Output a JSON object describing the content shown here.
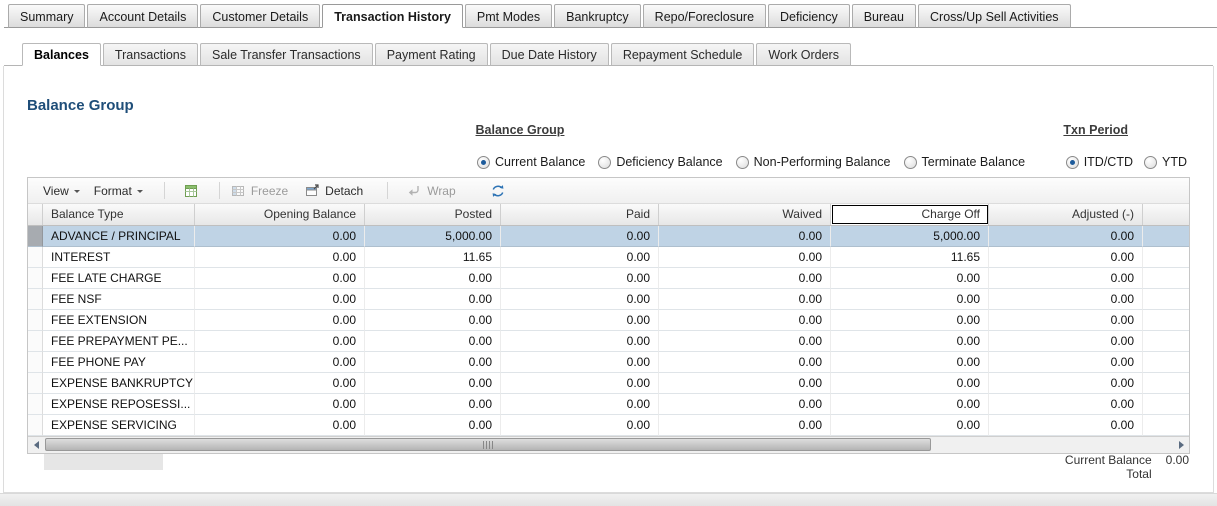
{
  "colors": {
    "heading": "#1f4e79",
    "selected_row": "#bfd3e5",
    "accent_blue": "#1d5b9b"
  },
  "tabs": {
    "top": [
      {
        "label": "Summary",
        "active": false
      },
      {
        "label": "Account Details",
        "active": false
      },
      {
        "label": "Customer Details",
        "active": false
      },
      {
        "label": "Transaction History",
        "active": true
      },
      {
        "label": "Pmt Modes",
        "active": false
      },
      {
        "label": "Bankruptcy",
        "active": false
      },
      {
        "label": "Repo/Foreclosure",
        "active": false
      },
      {
        "label": "Deficiency",
        "active": false
      },
      {
        "label": "Bureau",
        "active": false
      },
      {
        "label": "Cross/Up Sell Activities",
        "active": false
      }
    ],
    "sub": [
      {
        "label": "Balances",
        "active": true
      },
      {
        "label": "Transactions",
        "active": false
      },
      {
        "label": "Sale Transfer Transactions",
        "active": false
      },
      {
        "label": "Payment Rating",
        "active": false
      },
      {
        "label": "Due Date History",
        "active": false
      },
      {
        "label": "Repayment Schedule",
        "active": false
      },
      {
        "label": "Work Orders",
        "active": false
      }
    ]
  },
  "section_title": "Balance Group",
  "filters": {
    "balance_group_label": "Balance Group",
    "txn_period_label": "Txn Period",
    "balance_group_options": [
      {
        "label": "Current Balance",
        "selected": true
      },
      {
        "label": "Deficiency Balance",
        "selected": false
      },
      {
        "label": "Non-Performing Balance",
        "selected": false
      },
      {
        "label": "Terminate Balance",
        "selected": false
      }
    ],
    "txn_period_options": [
      {
        "label": "ITD/CTD",
        "selected": true
      },
      {
        "label": "YTD",
        "selected": false
      }
    ]
  },
  "toolbar": {
    "view": "View",
    "format": "Format",
    "freeze": "Freeze",
    "detach": "Detach",
    "wrap": "Wrap",
    "icons": {
      "view_menu": "chevron-down-icon",
      "format_menu": "chevron-down-icon",
      "export": "export-icon",
      "freeze": "freeze-icon",
      "detach": "detach-icon",
      "wrap": "wrap-icon",
      "refresh": "refresh-icon"
    }
  },
  "table": {
    "columns": [
      {
        "label": "Balance Type",
        "focus_box": false
      },
      {
        "label": "Opening Balance",
        "focus_box": false
      },
      {
        "label": "Posted",
        "focus_box": false
      },
      {
        "label": "Paid",
        "focus_box": false
      },
      {
        "label": "Waived",
        "focus_box": false
      },
      {
        "label": "Charge Off",
        "focus_box": true
      },
      {
        "label": "Adjusted (-)",
        "focus_box": false
      }
    ],
    "rows": [
      {
        "selected": true,
        "cells": [
          "ADVANCE / PRINCIPAL",
          "0.00",
          "5,000.00",
          "0.00",
          "0.00",
          "5,000.00",
          "0.00"
        ]
      },
      {
        "selected": false,
        "cells": [
          "INTEREST",
          "0.00",
          "11.65",
          "0.00",
          "0.00",
          "11.65",
          "0.00"
        ]
      },
      {
        "selected": false,
        "cells": [
          "FEE LATE CHARGE",
          "0.00",
          "0.00",
          "0.00",
          "0.00",
          "0.00",
          "0.00"
        ]
      },
      {
        "selected": false,
        "cells": [
          "FEE NSF",
          "0.00",
          "0.00",
          "0.00",
          "0.00",
          "0.00",
          "0.00"
        ]
      },
      {
        "selected": false,
        "cells": [
          "FEE EXTENSION",
          "0.00",
          "0.00",
          "0.00",
          "0.00",
          "0.00",
          "0.00"
        ]
      },
      {
        "selected": false,
        "cells": [
          "FEE PREPAYMENT PE...",
          "0.00",
          "0.00",
          "0.00",
          "0.00",
          "0.00",
          "0.00"
        ]
      },
      {
        "selected": false,
        "cells": [
          "FEE PHONE PAY",
          "0.00",
          "0.00",
          "0.00",
          "0.00",
          "0.00",
          "0.00"
        ]
      },
      {
        "selected": false,
        "cells": [
          "EXPENSE BANKRUPTCY",
          "0.00",
          "0.00",
          "0.00",
          "0.00",
          "0.00",
          "0.00"
        ]
      },
      {
        "selected": false,
        "cells": [
          "EXPENSE REPOSESSI...",
          "0.00",
          "0.00",
          "0.00",
          "0.00",
          "0.00",
          "0.00"
        ]
      },
      {
        "selected": false,
        "cells": [
          "EXPENSE SERVICING",
          "0.00",
          "0.00",
          "0.00",
          "0.00",
          "0.00",
          "0.00"
        ]
      }
    ]
  },
  "footer": {
    "label_line1": "Current Balance",
    "label_line2": "Total",
    "value": "0.00"
  }
}
